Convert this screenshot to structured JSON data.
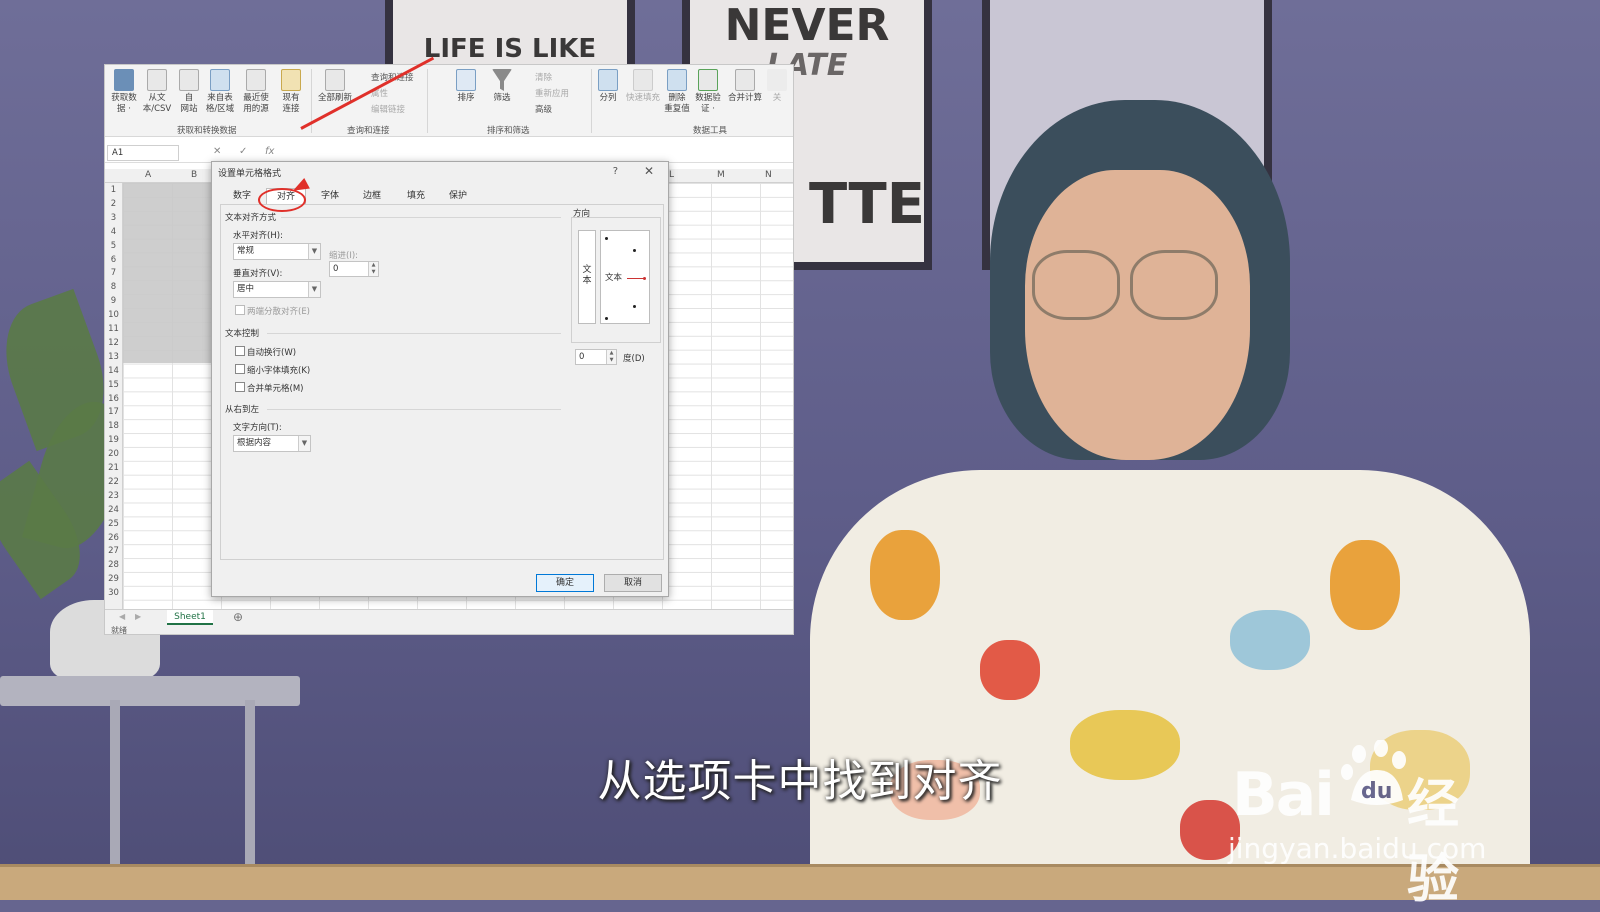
{
  "video": {
    "subtitle": "从选项卡中找到对齐",
    "watermark": {
      "brand_prefix": "Bai",
      "brand_du": "du",
      "brand_suffix": "经验",
      "url": "jingyan.baidu.com"
    },
    "posters": [
      {
        "text": "LIFE IS LIKE"
      },
      {
        "text1": "NEVER",
        "text2": "LATE",
        "text3": "TTE"
      }
    ]
  },
  "excel": {
    "ribbon": {
      "groups": [
        {
          "label": "获取和转换数据",
          "items": [
            "获取数\n据 ·",
            "从文\n本/CSV",
            "自\n网站",
            "来自表\n格/区域",
            "最近使\n用的源",
            "现有\n连接"
          ]
        },
        {
          "label": "查询和连接",
          "big": "全部刷新",
          "small": [
            "查询和连接",
            "属性",
            "编辑链接"
          ]
        },
        {
          "label": "排序和筛选",
          "big": [
            "排序",
            "筛选"
          ],
          "small": [
            "清除",
            "重新应用",
            "高级"
          ]
        },
        {
          "label": "数据工具",
          "items": [
            "分列",
            "快速填充",
            "删除\n重复值",
            "数据验\n证 ·",
            "合并计算",
            "关"
          ]
        }
      ]
    },
    "formula_bar": {
      "name_box": "A1",
      "fx": "fx"
    },
    "columns": [
      "A",
      "B",
      "L",
      "M",
      "N"
    ],
    "rows": [
      "1",
      "2",
      "3",
      "4",
      "5",
      "6",
      "7",
      "8",
      "9",
      "10",
      "11",
      "12",
      "13",
      "14",
      "15",
      "16",
      "17",
      "18",
      "19",
      "20",
      "21",
      "22",
      "23",
      "24",
      "25",
      "26",
      "27",
      "28",
      "29",
      "30"
    ],
    "sheet_tab": "Sheet1",
    "status": "就绪"
  },
  "dialog": {
    "title": "设置单元格格式",
    "help": "?",
    "close": "✕",
    "tabs": [
      "数字",
      "对齐",
      "字体",
      "边框",
      "填充",
      "保护"
    ],
    "active_tab": "对齐",
    "text_alignment": {
      "section": "文本对齐方式",
      "horizontal_label": "水平对齐(H):",
      "horizontal_value": "常规",
      "indent_label": "缩进(I):",
      "indent_value": "0",
      "vertical_label": "垂直对齐(V):",
      "vertical_value": "居中",
      "justify_distributed": "两端分散对齐(E)"
    },
    "text_control": {
      "section": "文本控制",
      "wrap": "自动换行(W)",
      "shrink": "缩小字体填充(K)",
      "merge": "合并单元格(M)"
    },
    "rtl": {
      "section": "从右到左",
      "direction_label": "文字方向(T):",
      "direction_value": "根据内容"
    },
    "orientation": {
      "section": "方向",
      "vertical_text": "文\n本",
      "dial_text": "文本",
      "degrees_value": "0",
      "degrees_label": "度(D)"
    },
    "ok": "确定",
    "cancel": "取消"
  },
  "colors": {
    "annotation": "#e0302a",
    "excel_green": "#217346",
    "accent_blue": "#0078d7"
  }
}
